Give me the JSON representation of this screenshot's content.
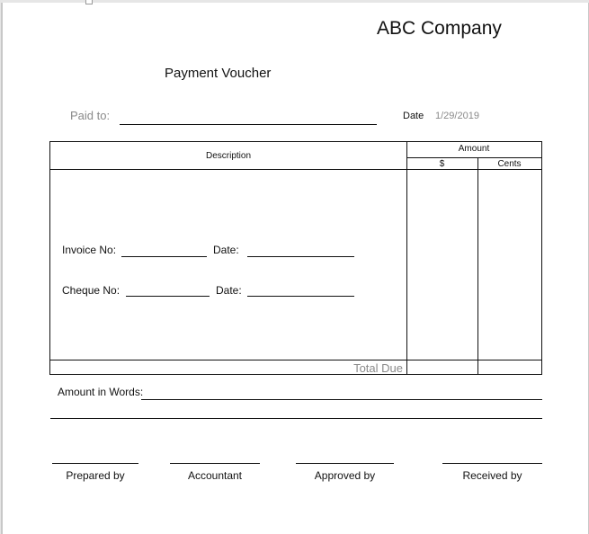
{
  "header": {
    "company": "ABC Company",
    "title": "Payment Voucher"
  },
  "paid_to": {
    "label": "Paid to:",
    "value": ""
  },
  "date": {
    "label": "Date",
    "value": "1/29/2019"
  },
  "table": {
    "description_header": "Description",
    "amount_header": "Amount",
    "dollars_header": "$",
    "cents_header": "Cents",
    "invoice_label": "Invoice No:",
    "invoice_date_label": "Date:",
    "cheque_label": "Cheque No:",
    "cheque_date_label": "Date:",
    "total_due_label": "Total Due"
  },
  "amount_in_words": {
    "label": "Amount in Words:"
  },
  "signatures": [
    {
      "label": "Prepared by"
    },
    {
      "label": "Accountant"
    },
    {
      "label": "Approved by"
    },
    {
      "label": "Received by"
    }
  ]
}
